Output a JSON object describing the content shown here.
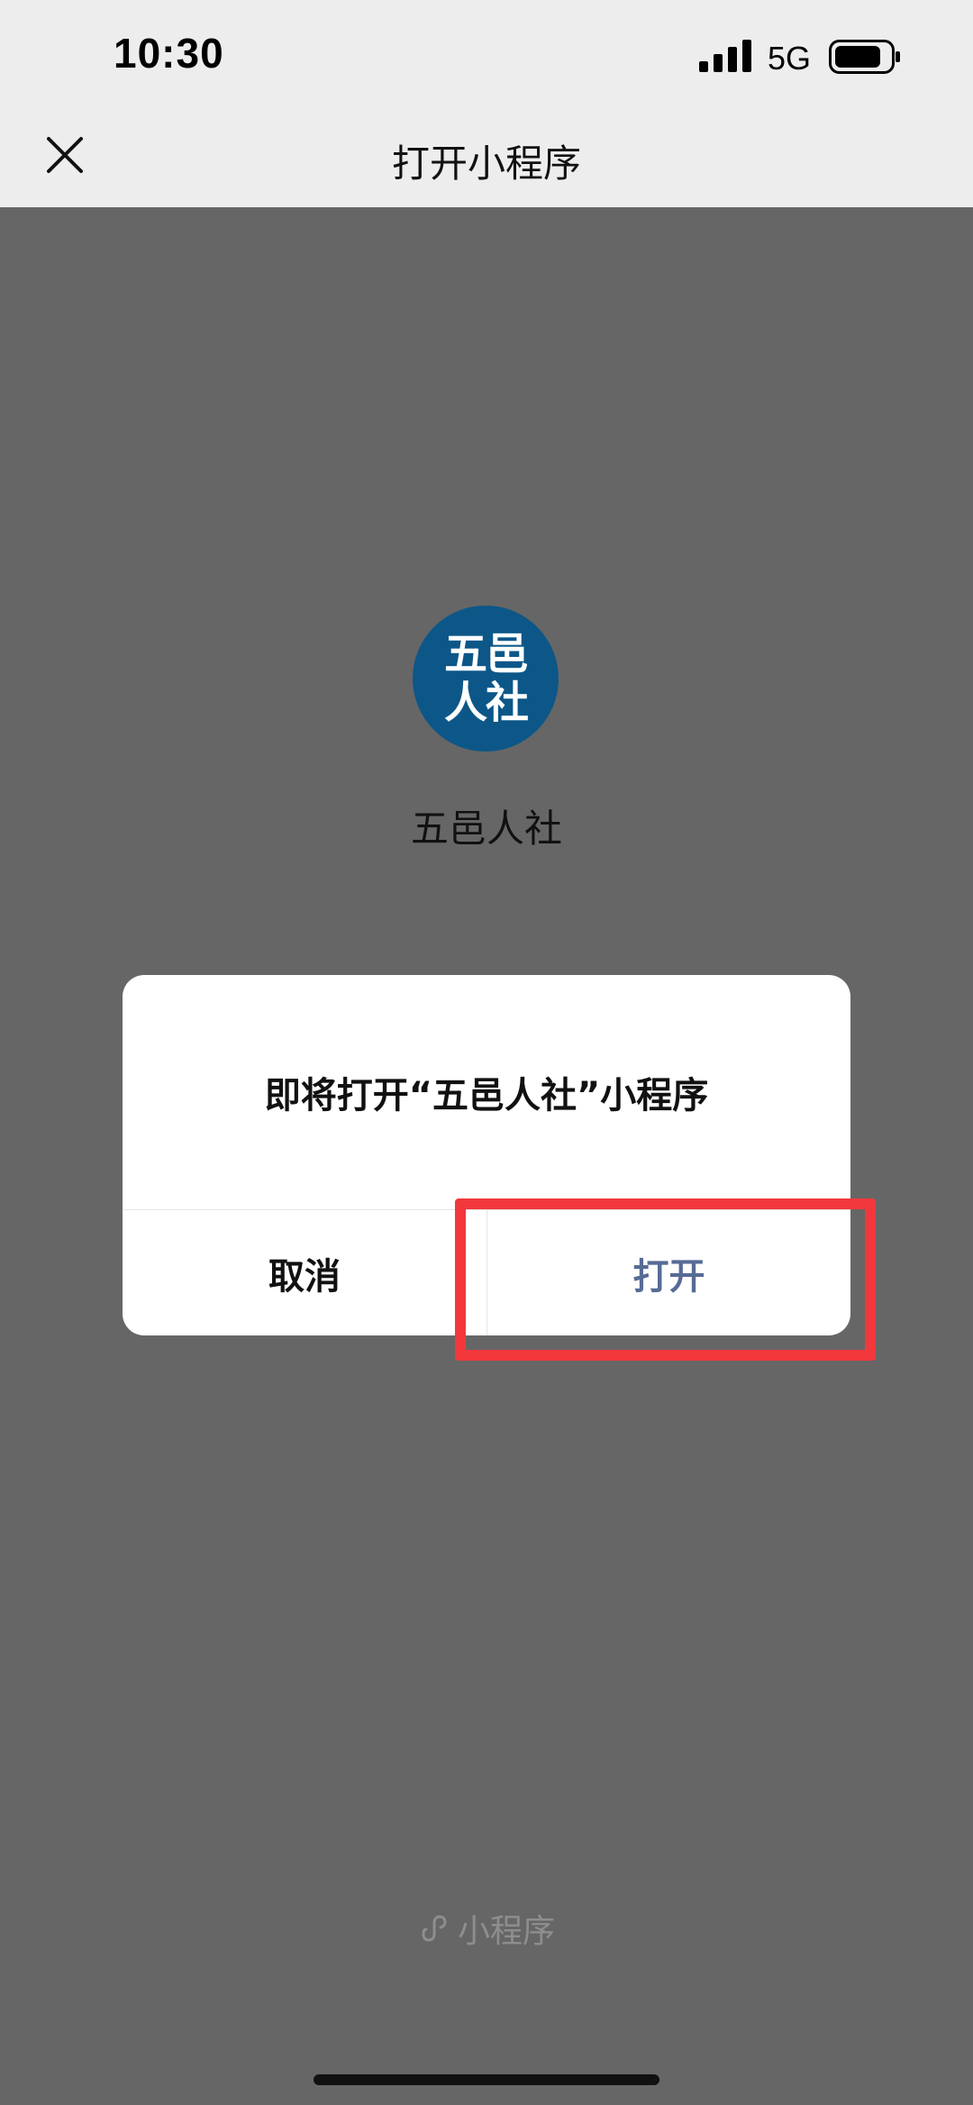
{
  "status_bar": {
    "time": "10:30",
    "network": "5G",
    "signal_icon": "signal-bars-icon",
    "battery_icon": "battery-icon"
  },
  "nav": {
    "title": "打开小程序",
    "close_icon": "close-icon"
  },
  "app": {
    "logo_line1": "五邑",
    "logo_line2": "人社",
    "name": "五邑人社",
    "logo_color": "#0c5788"
  },
  "dialog": {
    "message": "即将打开“五邑人社”小程序",
    "cancel_label": "取消",
    "open_label": "打开",
    "open_color": "#576b95",
    "highlight_color": "#f2383c"
  },
  "footer": {
    "brand_icon": "mini-program-icon",
    "brand_label": "小程序"
  }
}
